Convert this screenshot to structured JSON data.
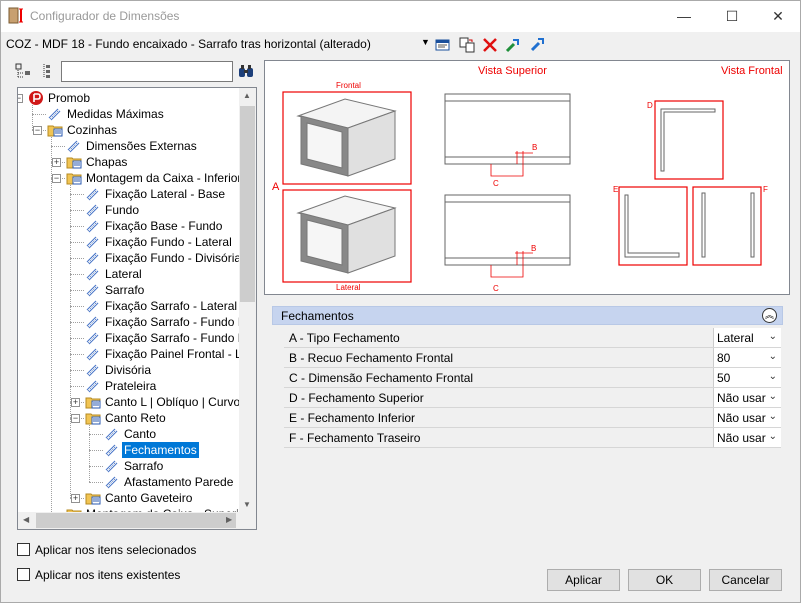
{
  "window": {
    "title": "Configurador de Dimensões",
    "minimize": "—",
    "maximize": "☐",
    "close": "✕"
  },
  "toolbar": {
    "item_title": "COZ - MDF 18 - Fundo encaixado - Sarrafo tras horizontal (alterado)",
    "dropdown": "▼"
  },
  "search": {
    "value": "",
    "placeholder": ""
  },
  "tree": {
    "items": [
      {
        "label": "Promob"
      },
      {
        "label": "Medidas Máximas"
      },
      {
        "label": "Cozinhas"
      },
      {
        "label": "Dimensões Externas"
      },
      {
        "label": "Chapas"
      },
      {
        "label": "Montagem da Caixa - Inferior"
      },
      {
        "label": "Fixação Lateral - Base"
      },
      {
        "label": "Fundo"
      },
      {
        "label": "Fixação Base - Fundo"
      },
      {
        "label": "Fixação Fundo - Lateral"
      },
      {
        "label": "Fixação Fundo - Divisória"
      },
      {
        "label": "Lateral"
      },
      {
        "label": "Sarrafo"
      },
      {
        "label": "Fixação Sarrafo - Lateral"
      },
      {
        "label": "Fixação Sarrafo - Fundo Inferior"
      },
      {
        "label": "Fixação Sarrafo - Fundo Frontal"
      },
      {
        "label": "Fixação Painel Frontal - Lateral"
      },
      {
        "label": "Divisória"
      },
      {
        "label": "Prateleira"
      },
      {
        "label": "Canto L | Oblíquo | Curvo"
      },
      {
        "label": "Canto Reto"
      },
      {
        "label": "Canto"
      },
      {
        "label": "Fechamentos"
      },
      {
        "label": "Sarrafo"
      },
      {
        "label": "Afastamento Parede"
      },
      {
        "label": "Canto Gaveteiro"
      },
      {
        "label": "Montagem da Caixa - Superior"
      }
    ]
  },
  "options": {
    "apply_selected": "Aplicar nos itens selecionados",
    "apply_existing": "Aplicar nos itens existentes"
  },
  "preview": {
    "vista_superior": "Vista Superior",
    "vista_frontal": "Vista Frontal",
    "frontal": "Frontal",
    "lateral": "Lateral",
    "A": "A",
    "B": "B",
    "C": "C",
    "D": "D",
    "E": "E",
    "F": "F"
  },
  "panel": {
    "title": "Fechamentos",
    "rows": [
      {
        "label": "A - Tipo Fechamento",
        "value": "Lateral"
      },
      {
        "label": "B - Recuo Fechamento Frontal",
        "value": "80"
      },
      {
        "label": "C - Dimensão Fechamento Frontal",
        "value": "50"
      },
      {
        "label": "D - Fechamento Superior",
        "value": "Não usar"
      },
      {
        "label": "E - Fechamento Inferior",
        "value": "Não usar"
      },
      {
        "label": "F - Fechamento Traseiro",
        "value": "Não usar"
      }
    ]
  },
  "buttons": {
    "apply": "Aplicar",
    "ok": "OK",
    "cancel": "Cancelar"
  },
  "colors": {
    "accent": "#0078d7",
    "annotation_red": "#e00000",
    "panel_header": "#c6d4ef"
  }
}
